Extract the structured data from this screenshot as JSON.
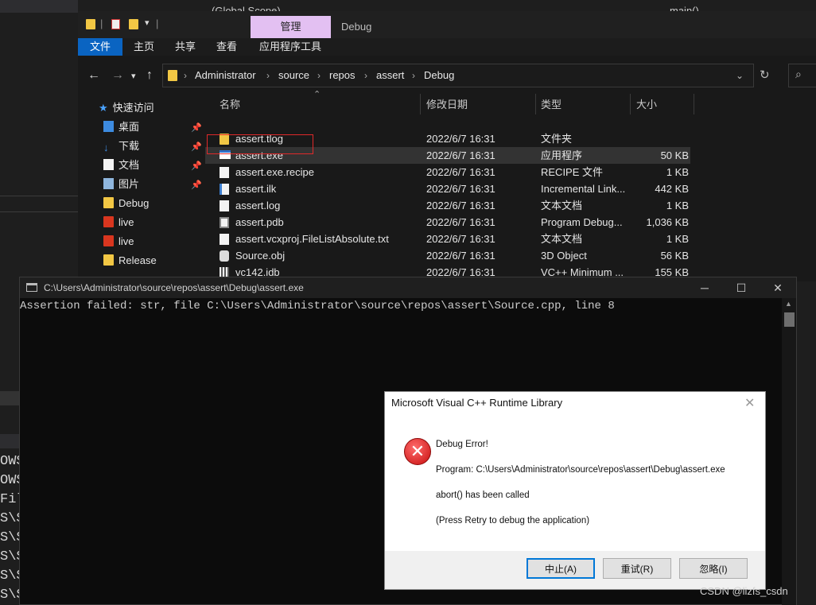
{
  "ide": {
    "scope": "(Global Scope)",
    "func": "main()",
    "bg_lines": [
      "OWS",
      "OWS",
      "File",
      "S\\S",
      "S\\S",
      "S\\S",
      "S\\S",
      "S\\S"
    ]
  },
  "explorer": {
    "ribbon": {
      "manage": "管理",
      "window_title": "Debug",
      "tabs": [
        "文件",
        "主页",
        "共享",
        "查看",
        "应用程序工具"
      ]
    },
    "breadcrumb": [
      "Administrator",
      "source",
      "repos",
      "assert",
      "Debug"
    ],
    "nav": {
      "quick_access": "快速访问",
      "items": [
        {
          "label": "桌面",
          "pinned": true
        },
        {
          "label": "下载",
          "pinned": true
        },
        {
          "label": "文档",
          "pinned": true
        },
        {
          "label": "图片",
          "pinned": true
        },
        {
          "label": "Debug",
          "pinned": false
        },
        {
          "label": "live",
          "pinned": false
        },
        {
          "label": "live",
          "pinned": false
        },
        {
          "label": "Release",
          "pinned": false
        }
      ]
    },
    "columns": {
      "name": "名称",
      "date": "修改日期",
      "type": "类型",
      "size": "大小"
    },
    "files": [
      {
        "name": "assert.tlog",
        "date": "2022/6/7 16:31",
        "type": "文件夹",
        "size": ""
      },
      {
        "name": "assert.exe",
        "date": "2022/6/7 16:31",
        "type": "应用程序",
        "size": "50 KB"
      },
      {
        "name": "assert.exe.recipe",
        "date": "2022/6/7 16:31",
        "type": "RECIPE 文件",
        "size": "1 KB"
      },
      {
        "name": "assert.ilk",
        "date": "2022/6/7 16:31",
        "type": "Incremental Link...",
        "size": "442 KB"
      },
      {
        "name": "assert.log",
        "date": "2022/6/7 16:31",
        "type": "文本文档",
        "size": "1 KB"
      },
      {
        "name": "assert.pdb",
        "date": "2022/6/7 16:31",
        "type": "Program Debug...",
        "size": "1,036 KB"
      },
      {
        "name": "assert.vcxproj.FileListAbsolute.txt",
        "date": "2022/6/7 16:31",
        "type": "文本文档",
        "size": "1 KB"
      },
      {
        "name": "Source.obj",
        "date": "2022/6/7 16:31",
        "type": "3D Object",
        "size": "56 KB"
      },
      {
        "name": "vc142.idb",
        "date": "2022/6/7 16:31",
        "type": "VC++ Minimum ...",
        "size": "155 KB"
      }
    ]
  },
  "console": {
    "title": "C:\\Users\\Administrator\\source\\repos\\assert\\Debug\\assert.exe",
    "output": "Assertion failed: str, file C:\\Users\\Administrator\\source\\repos\\assert\\Source.cpp, line 8",
    "min": "─",
    "max": "☐",
    "close": "✕"
  },
  "dialog": {
    "title": "Microsoft Visual C++ Runtime Library",
    "heading": "Debug Error!",
    "program": "Program: C:\\Users\\Administrator\\source\\repos\\assert\\Debug\\assert.exe",
    "message": "abort() has been called",
    "hint": "(Press Retry to debug the application)",
    "buttons": {
      "abort": "中止(A)",
      "retry": "重试(R)",
      "ignore": "忽略(I)"
    }
  },
  "watermark": "CSDN @lizfs_csdn"
}
